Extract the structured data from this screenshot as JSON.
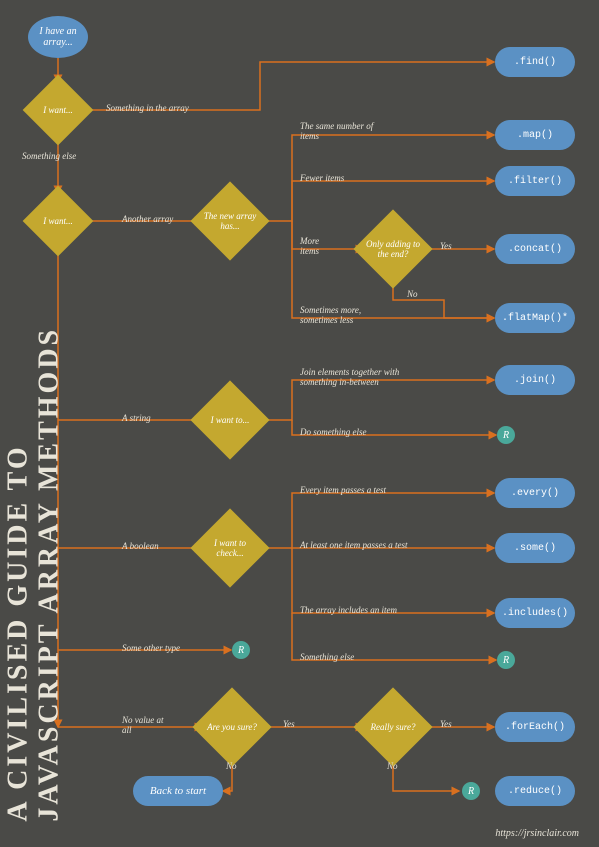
{
  "title_line1": "A CIVILISED GUIDE TO",
  "title_line2": "JAVASCRIPT ARRAY METHODS",
  "credit": "https://jrsinclair.com",
  "start": {
    "label": "I have an array..."
  },
  "diamonds": {
    "want1": "I want...",
    "want2": "I want...",
    "newarray": "The new array has...",
    "onlyend": "Only adding to the end?",
    "wantstring": "I want to...",
    "wantbool": "I want to check...",
    "sure": "Are you sure?",
    "really": "Really sure?"
  },
  "edges": {
    "somethinginarray": "Something in the array",
    "somethingelse": "Something else",
    "anotherarray": "Another array",
    "samenum": "The same number of items",
    "fewer": "Fewer items",
    "more": "More items",
    "sometimes": "Sometimes more, sometimes less",
    "yes": "Yes",
    "no": "No",
    "astring": "A string",
    "joinelems": "Join elements together with something in-between",
    "doelse": "Do something else",
    "abool": "A boolean",
    "everytest": "Every item passes a test",
    "atleastone": "At least one item passes a test",
    "includesitem": "The array includes an item",
    "someother": "Some other type",
    "novalue": "No value at all"
  },
  "methods": {
    "find": ".find()",
    "map": ".map()",
    "filter": ".filter()",
    "concat": ".concat()",
    "flatmap": ".flatMap()*",
    "join": ".join()",
    "every": ".every()",
    "some": ".some()",
    "includes": ".includes()",
    "foreach": ".forEach()",
    "reduce": ".reduce()"
  },
  "back": "Back to start",
  "r": "R"
}
